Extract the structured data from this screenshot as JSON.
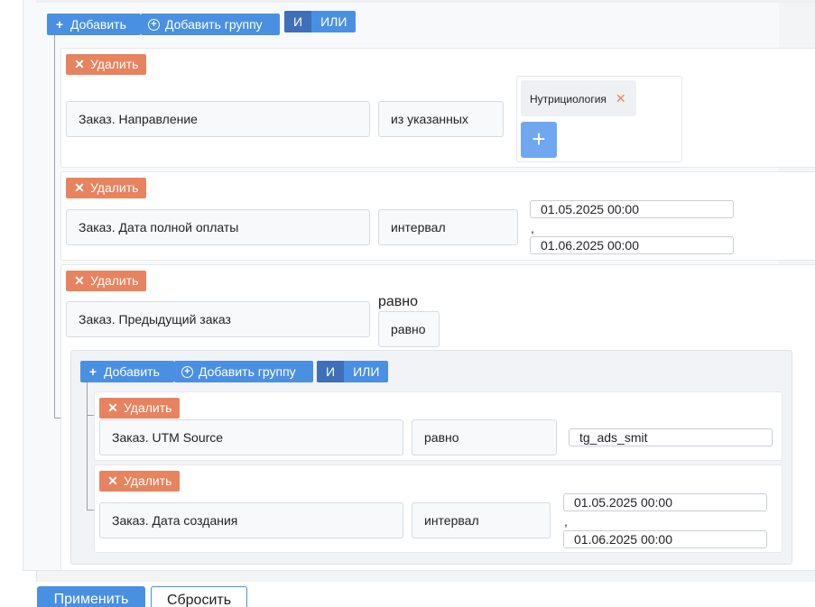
{
  "root_group": {
    "add_label": "Добавить",
    "add_group_label": "Добавить группу",
    "and_label": "И",
    "or_label": "ИЛИ"
  },
  "rules": [
    {
      "delete_label": "Удалить",
      "field": "Заказ. Направление",
      "operator": "из указанных",
      "tags": [
        "Нутрициология"
      ]
    },
    {
      "delete_label": "Удалить",
      "field": "Заказ. Дата полной оплаты",
      "operator": "интервал",
      "from": "01.05.2025 00:00",
      "separator": ",",
      "to": "01.06.2025 00:00"
    },
    {
      "delete_label": "Удалить",
      "field": "Заказ. Предыдущий заказ",
      "operator_label": "равно",
      "operator": "равно"
    }
  ],
  "nested_group": {
    "add_label": "Добавить",
    "add_group_label": "Добавить группу",
    "and_label": "И",
    "or_label": "ИЛИ",
    "rules": [
      {
        "delete_label": "Удалить",
        "field": "Заказ. UTM Source",
        "operator": "равно",
        "value": "tg_ads_smit"
      },
      {
        "delete_label": "Удалить",
        "field": "Заказ. Дата создания",
        "operator": "интервал",
        "from": "01.05.2025 00:00",
        "separator": ",",
        "to": "01.06.2025 00:00"
      }
    ]
  },
  "footer": {
    "apply_label": "Применить",
    "reset_label": "Сбросить"
  },
  "icons": {
    "add": "plus-icon",
    "add_group": "plus-circle-icon",
    "delete": "close-icon",
    "tag_remove": "close-icon"
  },
  "colors": {
    "primary": "#4a90e2",
    "primary_active": "#3e6fb8",
    "danger": "#e8835f",
    "plus_button": "#6fa8f0"
  }
}
